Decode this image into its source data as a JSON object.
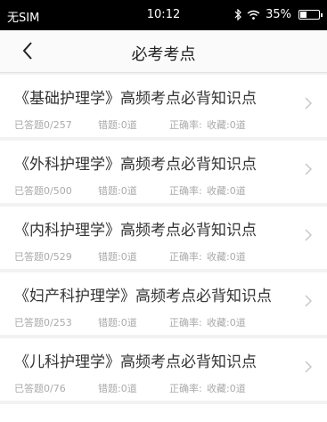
{
  "status_bar": {
    "carrier": "无SIM",
    "time": "10:12",
    "battery": "35%",
    "battery_level": 0.35
  },
  "nav": {
    "title": "必考考点"
  },
  "items": [
    {
      "title": "《基础护理学》高频考点必背知识点",
      "answered": "已答题0/257",
      "wrong": "错题:0道",
      "accuracy": "正确率:",
      "favorites": "收藏:0道"
    },
    {
      "title": "《外科护理学》高频考点必背知识点",
      "answered": "已答题0/500",
      "wrong": "错题:0道",
      "accuracy": "正确率:",
      "favorites": "收藏:0道"
    },
    {
      "title": "《内科护理学》高频考点必背知识点",
      "answered": "已答题0/529",
      "wrong": "错题:0道",
      "accuracy": "正确率:",
      "favorites": "收藏:0道"
    },
    {
      "title": "《妇产科护理学》高频考点必背知识点",
      "answered": "已答题0/253",
      "wrong": "错题:0道",
      "accuracy": "正确率:",
      "favorites": "收藏:0道"
    },
    {
      "title": "《儿科护理学》高频考点必背知识点",
      "answered": "已答题0/76",
      "wrong": "错题:0道",
      "accuracy": "正确率:",
      "favorites": "收藏:0道"
    }
  ],
  "icons": {
    "back": "chevron-left-icon",
    "row": "chevron-right-icon",
    "bluetooth": "bluetooth-icon",
    "wifi": "wifi-icon",
    "battery": "battery-icon"
  }
}
